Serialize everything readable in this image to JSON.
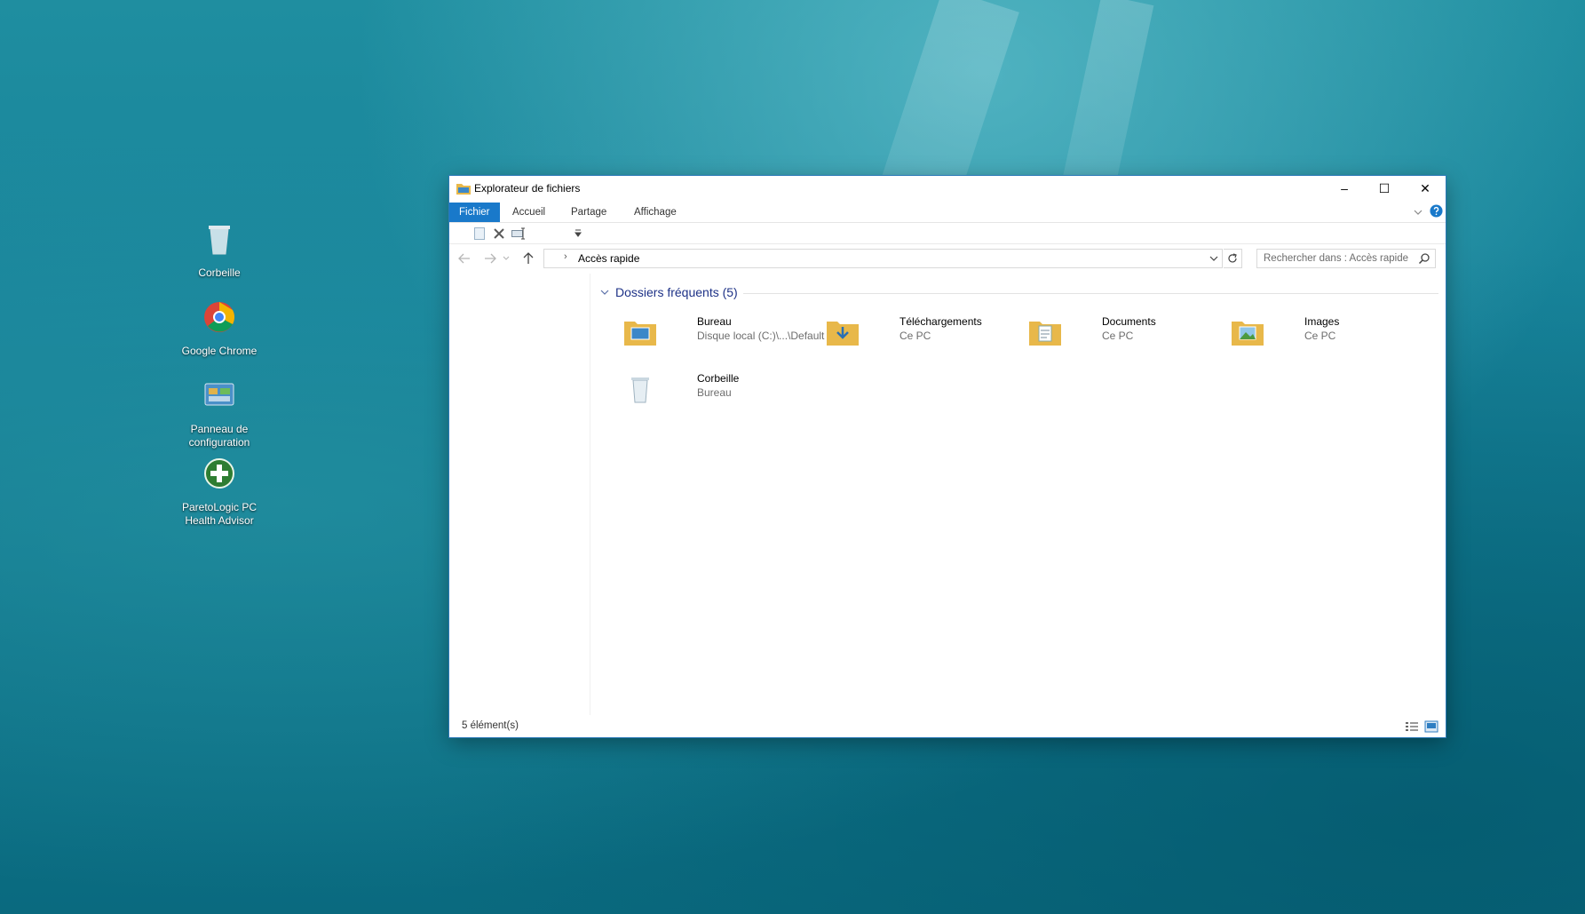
{
  "desktop": {
    "icons": [
      {
        "label": "Corbeille",
        "icon": "recycle-bin-icon"
      },
      {
        "label": "Google Chrome",
        "icon": "chrome-icon"
      },
      {
        "label": "Panneau de configuration",
        "icon": "control-panel-icon"
      },
      {
        "label": "ParetoLogic PC Health Advisor",
        "icon": "health-advisor-icon"
      }
    ]
  },
  "window": {
    "title": "Explorateur de fichiers",
    "controls": {
      "minimize": "–",
      "maximize": "☐",
      "close": "✕"
    },
    "tabs": [
      {
        "label": "Fichier",
        "active": true
      },
      {
        "label": "Accueil",
        "active": false
      },
      {
        "label": "Partage",
        "active": false
      },
      {
        "label": "Affichage",
        "active": false
      }
    ],
    "address": {
      "path": "Accès rapide"
    },
    "search": {
      "placeholder": "Rechercher dans : Accès rapide"
    },
    "group": {
      "title": "Dossiers fréquents (5)"
    },
    "items": [
      {
        "name": "Bureau",
        "location": "Disque local (C:)\\...\\Default",
        "icon": "desktop-folder-icon"
      },
      {
        "name": "Téléchargements",
        "location": "Ce PC",
        "icon": "downloads-folder-icon"
      },
      {
        "name": "Documents",
        "location": "Ce PC",
        "icon": "documents-folder-icon"
      },
      {
        "name": "Images",
        "location": "Ce PC",
        "icon": "pictures-folder-icon"
      },
      {
        "name": "Corbeille",
        "location": "Bureau",
        "icon": "recycle-bin-icon"
      }
    ],
    "status": {
      "count": "5 élément(s)"
    }
  },
  "colors": {
    "accent": "#1979ca",
    "group_title": "#1e3287",
    "folder": "#e8b84a"
  }
}
